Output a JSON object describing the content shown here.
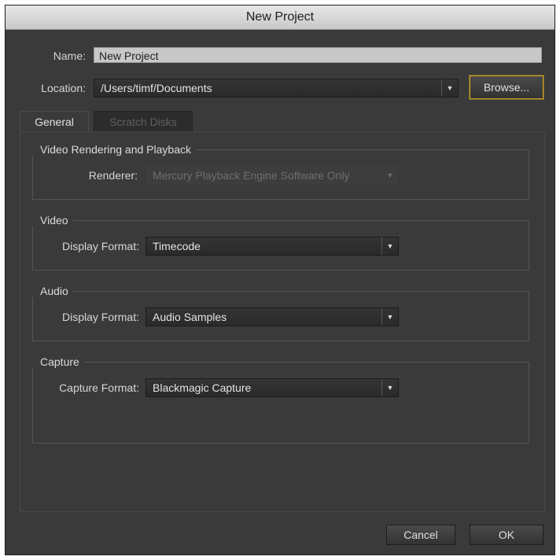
{
  "window": {
    "title": "New Project"
  },
  "form": {
    "name_label": "Name:",
    "name_value": "New Project",
    "location_label": "Location:",
    "location_value": "/Users/timf/Documents",
    "browse_label": "Browse..."
  },
  "tabs": [
    {
      "label": "General",
      "active": true
    },
    {
      "label": "Scratch Disks",
      "active": false
    }
  ],
  "sections": {
    "rendering": {
      "title": "Video Rendering and Playback",
      "renderer_label": "Renderer:",
      "renderer_value": "Mercury Playback Engine Software Only"
    },
    "video": {
      "title": "Video",
      "format_label": "Display Format:",
      "format_value": "Timecode"
    },
    "audio": {
      "title": "Audio",
      "format_label": "Display Format:",
      "format_value": "Audio Samples"
    },
    "capture": {
      "title": "Capture",
      "format_label": "Capture Format:",
      "format_value": "Blackmagic Capture"
    }
  },
  "buttons": {
    "cancel": "Cancel",
    "ok": "OK"
  },
  "icons": {
    "dropdown_arrow": "▼"
  }
}
